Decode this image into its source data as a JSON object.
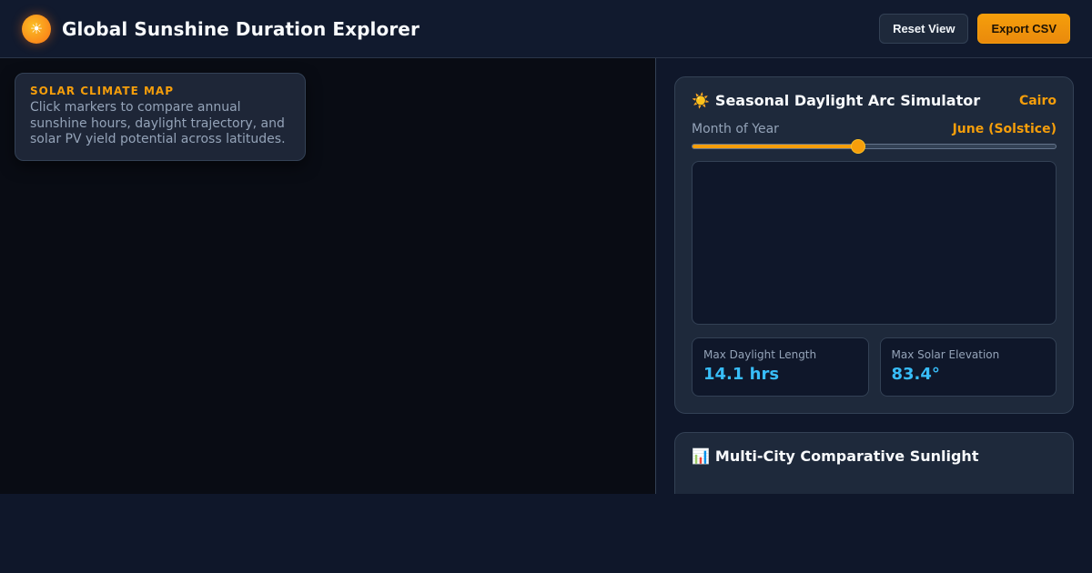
{
  "header": {
    "logo_glyph": "☀",
    "title": "Global Sunshine Duration Explorer",
    "reset_label": "Reset View",
    "export_label": "Export CSV"
  },
  "map": {
    "info_title": "SOLAR CLIMATE MAP",
    "info_text": "Click markers to compare annual sunshine hours, daylight trajectory, and solar PV yield potential across latitudes."
  },
  "arc_simulator": {
    "icon": "☀️",
    "title": "Seasonal Daylight Arc Simulator",
    "city": "Cairo",
    "month_label": "Month of Year",
    "month_value": "June (Solstice)",
    "month_position_fraction": 0.455,
    "stats": [
      {
        "label": "Max Daylight Length",
        "value": "14.1 hrs"
      },
      {
        "label": "Max Solar Elevation",
        "value": "83.4°"
      }
    ]
  },
  "compare": {
    "icon": "📊",
    "title": "Multi-City Comparative Sunlight"
  },
  "colors": {
    "accent": "#f59e0b",
    "stat_value": "#38bdf8",
    "background": "#0f172a",
    "card": "#1e293b"
  }
}
